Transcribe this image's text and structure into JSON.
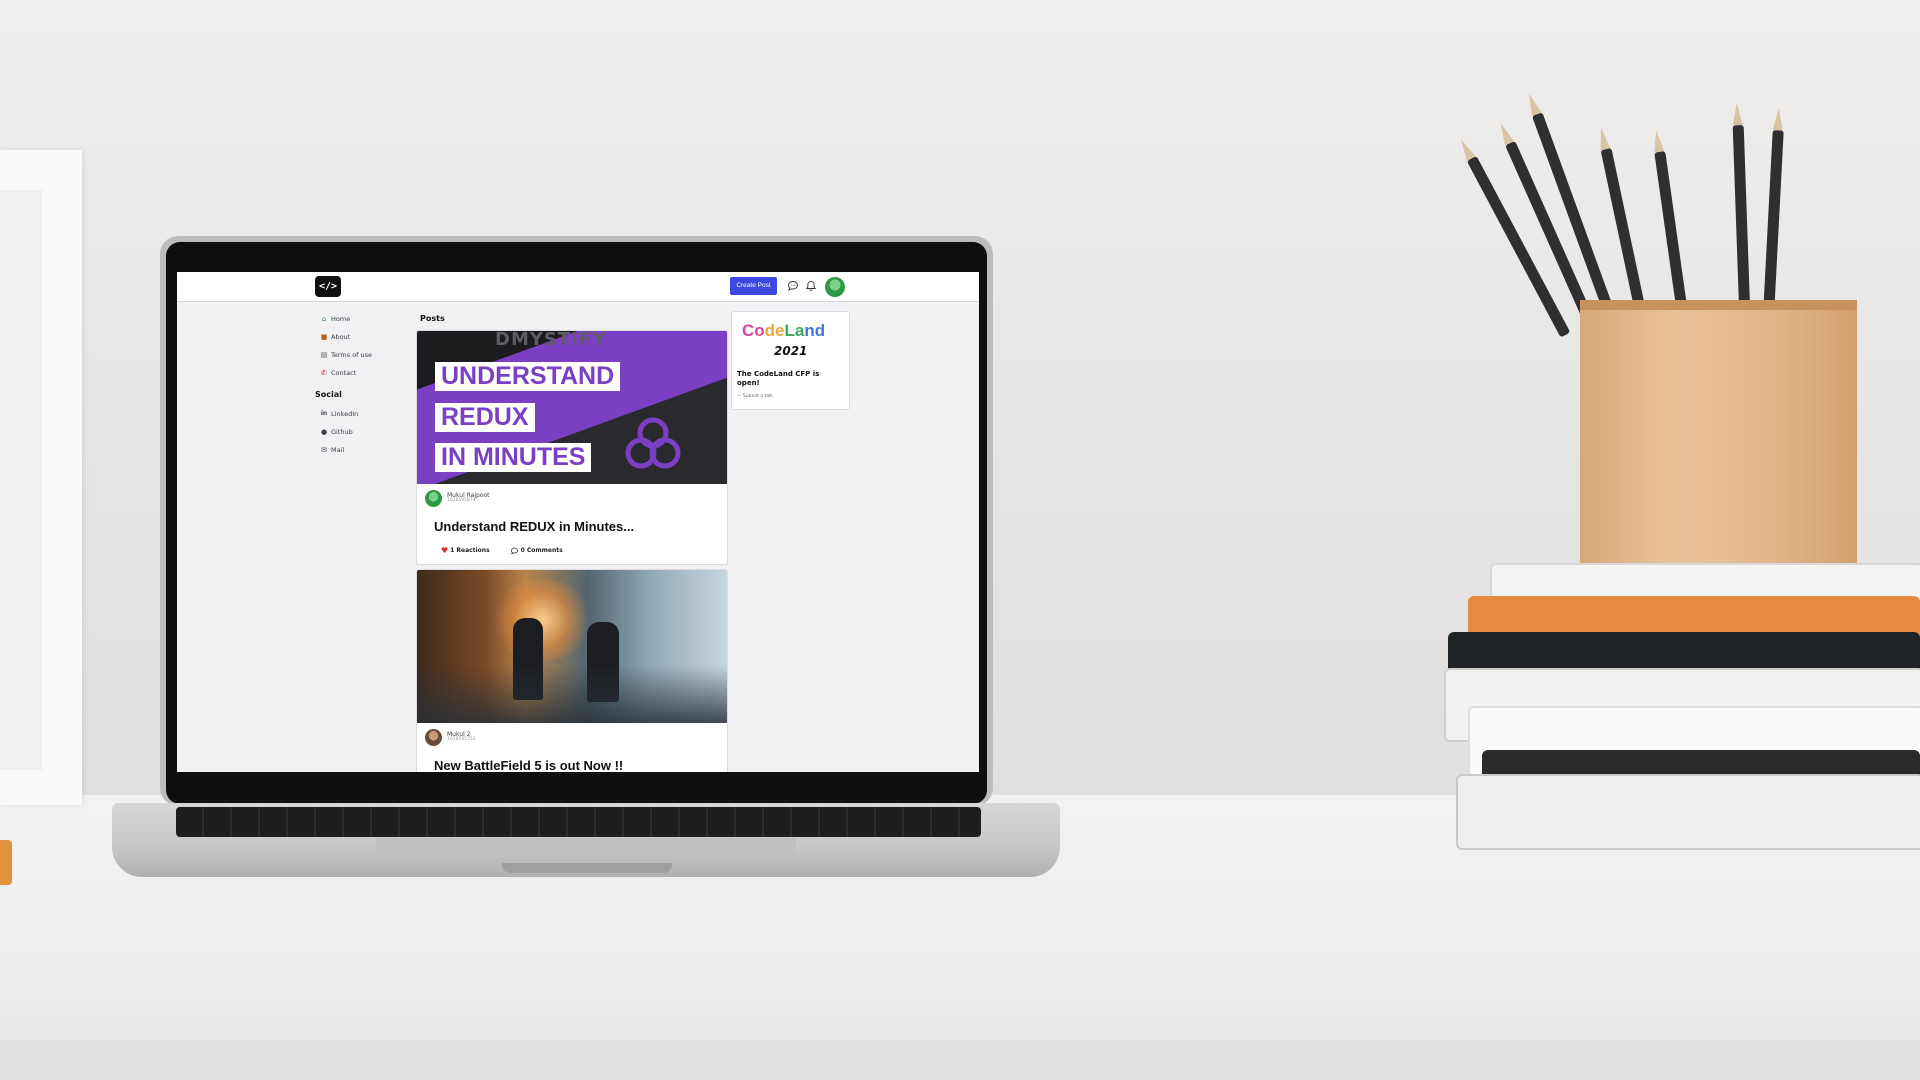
{
  "navbar": {
    "logo_text": "</>",
    "create_post_label": "Create Post",
    "icons": [
      "chat-icon",
      "bell-icon"
    ]
  },
  "sidebar": {
    "items": [
      {
        "label": "Home",
        "icon": "home-icon"
      },
      {
        "label": "About",
        "icon": "about-icon"
      },
      {
        "label": "Terms of use",
        "icon": "terms-icon"
      },
      {
        "label": "Contact",
        "icon": "phone-icon"
      }
    ],
    "social_heading": "Social",
    "social_items": [
      {
        "label": "LinkedIn",
        "icon": "linkedin-icon"
      },
      {
        "label": "Github",
        "icon": "github-icon"
      },
      {
        "label": "Mail",
        "icon": "mail-icon"
      }
    ]
  },
  "main": {
    "posts_heading": "Posts",
    "posts": [
      {
        "cover": {
          "faded_text": "DMYSTIFY",
          "lines": [
            "UNDERSTAND",
            "REDUX",
            "IN MINUTES"
          ]
        },
        "author": "Mukul Rajpoot",
        "date": "1628595874",
        "title": "Understand REDUX in Minutes...",
        "reactions": "1 Reactions",
        "comments": "0 Comments"
      },
      {
        "author": "Mukul 2",
        "date": "1628595752",
        "title": "New BattleField 5 is out Now !!"
      }
    ]
  },
  "promo": {
    "logo_text": "CodeLand",
    "year": "2021",
    "title": "The CodeLand CFP is open!",
    "subtitle": "— Submit a talk"
  },
  "colors": {
    "accent": "#3b49df",
    "redux_purple": "#7b3fc4",
    "reaction_heart": "#d0312d"
  }
}
